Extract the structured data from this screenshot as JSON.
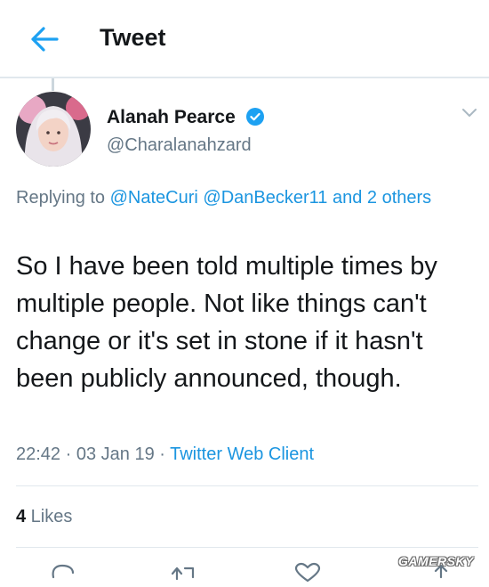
{
  "header": {
    "title": "Tweet"
  },
  "author": {
    "name": "Alanah Pearce",
    "handle": "@Charalanahzard",
    "verified": true
  },
  "reply": {
    "prefix": "Replying to ",
    "mention1": "@NateCuri",
    "mention2": "@DanBecker11",
    "others": "and 2 others"
  },
  "tweet": {
    "text": "So I have been told multiple times by multiple people. Not like things can't change or it's set in stone if it hasn't been publicly announced, though."
  },
  "meta": {
    "time": "22:42",
    "date": "03 Jan 19",
    "client": "Twitter Web Client",
    "separator": " · "
  },
  "stats": {
    "likes_count": "4",
    "likes_label": " Likes"
  },
  "watermark": "GAMERSKY",
  "colors": {
    "accent": "#1b95e0",
    "text": "#14171a",
    "secondary": "#657786",
    "divider": "#e1e8ed"
  },
  "icons": [
    "back-arrow-icon",
    "verified-badge-icon",
    "chevron-down-icon",
    "reply-icon",
    "retweet-icon",
    "like-icon",
    "share-icon"
  ]
}
